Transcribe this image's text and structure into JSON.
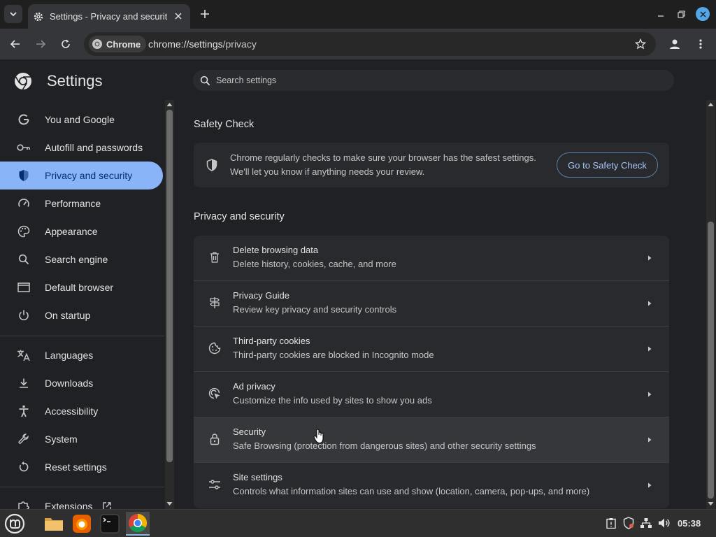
{
  "browser": {
    "tab_title": "Settings - Privacy and security",
    "chip_label": "Chrome",
    "url_host": "chrome://settings",
    "url_path": "/privacy"
  },
  "settings": {
    "title": "Settings",
    "search_placeholder": "Search settings"
  },
  "sidebar": {
    "items": [
      {
        "label": "You and Google",
        "icon": "google-icon"
      },
      {
        "label": "Autofill and passwords",
        "icon": "key-icon"
      },
      {
        "label": "Privacy and security",
        "icon": "shield-icon",
        "active": true
      },
      {
        "label": "Performance",
        "icon": "speedometer-icon"
      },
      {
        "label": "Appearance",
        "icon": "palette-icon"
      },
      {
        "label": "Search engine",
        "icon": "search-icon"
      },
      {
        "label": "Default browser",
        "icon": "browser-window-icon"
      },
      {
        "label": "On startup",
        "icon": "power-icon"
      },
      {
        "label": "Languages",
        "icon": "translate-icon"
      },
      {
        "label": "Downloads",
        "icon": "download-icon"
      },
      {
        "label": "Accessibility",
        "icon": "accessibility-icon"
      },
      {
        "label": "System",
        "icon": "wrench-icon"
      },
      {
        "label": "Reset settings",
        "icon": "reset-icon"
      },
      {
        "label": "Extensions",
        "icon": "puzzle-icon"
      }
    ]
  },
  "safety_check": {
    "heading": "Safety Check",
    "line1": "Chrome regularly checks to make sure your browser has the safest settings.",
    "line2": "We'll let you know if anything needs your review.",
    "button": "Go to Safety Check"
  },
  "privacy": {
    "heading": "Privacy and security",
    "rows": [
      {
        "title": "Delete browsing data",
        "subtitle": "Delete history, cookies, cache, and more",
        "icon": "trash-icon"
      },
      {
        "title": "Privacy Guide",
        "subtitle": "Review key privacy and security controls",
        "icon": "signpost-icon"
      },
      {
        "title": "Third-party cookies",
        "subtitle": "Third-party cookies are blocked in Incognito mode",
        "icon": "cookie-icon"
      },
      {
        "title": "Ad privacy",
        "subtitle": "Customize the info used by sites to show you ads",
        "icon": "ad-privacy-icon"
      },
      {
        "title": "Security",
        "subtitle": "Safe Browsing (protection from dangerous sites) and other security settings",
        "icon": "lock-icon"
      },
      {
        "title": "Site settings",
        "subtitle": "Controls what information sites can use and show (location, camera, pop-ups, and more)",
        "icon": "sliders-icon"
      }
    ]
  },
  "taskbar": {
    "clock": "05:38"
  },
  "colors": {
    "accent": "#8ab4f8",
    "active_text": "#062e6f",
    "background": "#202124",
    "card": "#292a2d"
  }
}
